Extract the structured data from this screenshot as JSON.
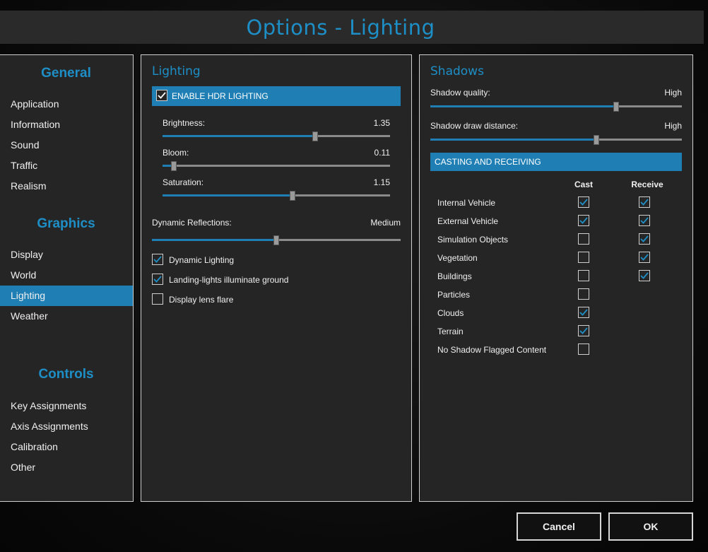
{
  "window": {
    "title": "Options - Lighting"
  },
  "nav": {
    "sections": [
      {
        "heading": "General",
        "items": [
          "Application",
          "Information",
          "Sound",
          "Traffic",
          "Realism"
        ]
      },
      {
        "heading": "Graphics",
        "items": [
          "Display",
          "World",
          "Lighting",
          "Weather"
        ]
      },
      {
        "heading": "Controls",
        "items": [
          "Key Assignments",
          "Axis Assignments",
          "Calibration",
          "Other"
        ]
      }
    ],
    "active": "Lighting"
  },
  "lighting": {
    "title": "Lighting",
    "hdr": {
      "label": "ENABLE HDR LIGHTING",
      "checked": true
    },
    "brightness": {
      "label": "Brightness:",
      "value": "1.35",
      "level": 0.67
    },
    "bloom": {
      "label": "Bloom:",
      "value": "0.11",
      "level": 0.05
    },
    "saturation": {
      "label": "Saturation:",
      "value": "1.15",
      "level": 0.57
    },
    "reflections": {
      "label": "Dynamic Reflections:",
      "value": "Medium",
      "level": 0.5
    },
    "options": [
      {
        "label": "Dynamic Lighting",
        "checked": true
      },
      {
        "label": "Landing-lights illuminate ground",
        "checked": true
      },
      {
        "label": "Display lens flare",
        "checked": false
      }
    ]
  },
  "shadows": {
    "title": "Shadows",
    "quality": {
      "label": "Shadow quality:",
      "value": "High",
      "level": 0.74
    },
    "distance": {
      "label": "Shadow draw distance:",
      "value": "High",
      "level": 0.66
    },
    "casting": {
      "heading": "CASTING AND RECEIVING",
      "cast_header": "Cast",
      "receive_header": "Receive",
      "rows": [
        {
          "label": "Internal Vehicle",
          "cast": true,
          "receive": true
        },
        {
          "label": "External Vehicle",
          "cast": true,
          "receive": true
        },
        {
          "label": "Simulation Objects",
          "cast": false,
          "receive": true
        },
        {
          "label": "Vegetation",
          "cast": false,
          "receive": true
        },
        {
          "label": "Buildings",
          "cast": false,
          "receive": true
        },
        {
          "label": "Particles",
          "cast": false,
          "receive": null
        },
        {
          "label": "Clouds",
          "cast": true,
          "receive": null
        },
        {
          "label": "Terrain",
          "cast": true,
          "receive": null
        },
        {
          "label": "No Shadow Flagged Content",
          "cast": false,
          "receive": null
        }
      ]
    }
  },
  "buttons": {
    "cancel": "Cancel",
    "ok": "OK"
  },
  "colors": {
    "accent": "#1e8fc6",
    "highlight": "#1f7fb4",
    "panel": "#252525"
  }
}
